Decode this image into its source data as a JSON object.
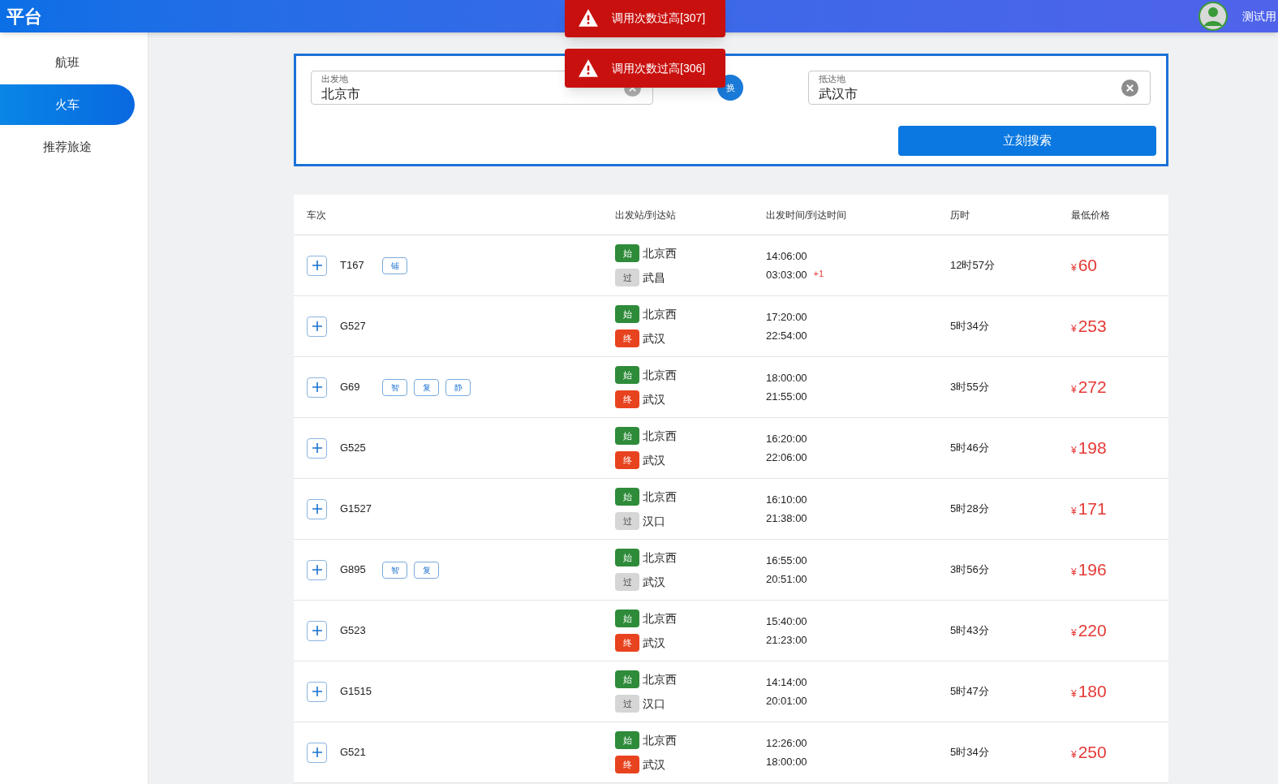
{
  "header": {
    "logo": "平台",
    "user": "测试用"
  },
  "sidebar": {
    "items": [
      {
        "label": "航班",
        "selected": false
      },
      {
        "label": "火车",
        "selected": true
      },
      {
        "label": "推荐旅途",
        "selected": false
      }
    ]
  },
  "toasts": [
    {
      "message": "调用次数过高[307]"
    },
    {
      "message": "调用次数过高[306]"
    }
  ],
  "search": {
    "from": {
      "label": "出发地",
      "value": "北京市"
    },
    "swap": "换",
    "to": {
      "label": "抵达地",
      "value": "武汉市"
    },
    "submit": "立刻搜索"
  },
  "table": {
    "columns": [
      "车次",
      "出发站/到达站",
      "出发时间/到达时间",
      "历时",
      "最低价格"
    ],
    "rows": [
      {
        "train": "T167",
        "tags": [
          "铺"
        ],
        "from": {
          "badge": "始",
          "kind": "start",
          "name": "北京西"
        },
        "to": {
          "badge": "过",
          "kind": "pass",
          "name": "武昌"
        },
        "depart": "14:06:00",
        "arrive": "03:03:00",
        "arrive_offset": "+1",
        "duration": "12时57分",
        "currency": "¥",
        "price": "60"
      },
      {
        "train": "G527",
        "tags": [],
        "from": {
          "badge": "始",
          "kind": "start",
          "name": "北京西"
        },
        "to": {
          "badge": "终",
          "kind": "end",
          "name": "武汉"
        },
        "depart": "17:20:00",
        "arrive": "22:54:00",
        "duration": "5时34分",
        "currency": "¥",
        "price": "253"
      },
      {
        "train": "G69",
        "tags": [
          "智",
          "复",
          "静"
        ],
        "from": {
          "badge": "始",
          "kind": "start",
          "name": "北京西"
        },
        "to": {
          "badge": "终",
          "kind": "end",
          "name": "武汉"
        },
        "depart": "18:00:00",
        "arrive": "21:55:00",
        "duration": "3时55分",
        "currency": "¥",
        "price": "272"
      },
      {
        "train": "G525",
        "tags": [],
        "from": {
          "badge": "始",
          "kind": "start",
          "name": "北京西"
        },
        "to": {
          "badge": "终",
          "kind": "end",
          "name": "武汉"
        },
        "depart": "16:20:00",
        "arrive": "22:06:00",
        "duration": "5时46分",
        "currency": "¥",
        "price": "198"
      },
      {
        "train": "G1527",
        "tags": [],
        "from": {
          "badge": "始",
          "kind": "start",
          "name": "北京西"
        },
        "to": {
          "badge": "过",
          "kind": "pass",
          "name": "汉口"
        },
        "depart": "16:10:00",
        "arrive": "21:38:00",
        "duration": "5时28分",
        "currency": "¥",
        "price": "171"
      },
      {
        "train": "G895",
        "tags": [
          "智",
          "复"
        ],
        "from": {
          "badge": "始",
          "kind": "start",
          "name": "北京西"
        },
        "to": {
          "badge": "过",
          "kind": "pass",
          "name": "武汉"
        },
        "depart": "16:55:00",
        "arrive": "20:51:00",
        "duration": "3时56分",
        "currency": "¥",
        "price": "196"
      },
      {
        "train": "G523",
        "tags": [],
        "from": {
          "badge": "始",
          "kind": "start",
          "name": "北京西"
        },
        "to": {
          "badge": "终",
          "kind": "end",
          "name": "武汉"
        },
        "depart": "15:40:00",
        "arrive": "21:23:00",
        "duration": "5时43分",
        "currency": "¥",
        "price": "220"
      },
      {
        "train": "G1515",
        "tags": [],
        "from": {
          "badge": "始",
          "kind": "start",
          "name": "北京西"
        },
        "to": {
          "badge": "过",
          "kind": "pass",
          "name": "汉口"
        },
        "depart": "14:14:00",
        "arrive": "20:01:00",
        "duration": "5时47分",
        "currency": "¥",
        "price": "180"
      },
      {
        "train": "G521",
        "tags": [],
        "from": {
          "badge": "始",
          "kind": "start",
          "name": "北京西"
        },
        "to": {
          "badge": "终",
          "kind": "end",
          "name": "武汉"
        },
        "depart": "12:26:00",
        "arrive": "18:00:00",
        "duration": "5时34分",
        "currency": "¥",
        "price": "250"
      }
    ]
  }
}
